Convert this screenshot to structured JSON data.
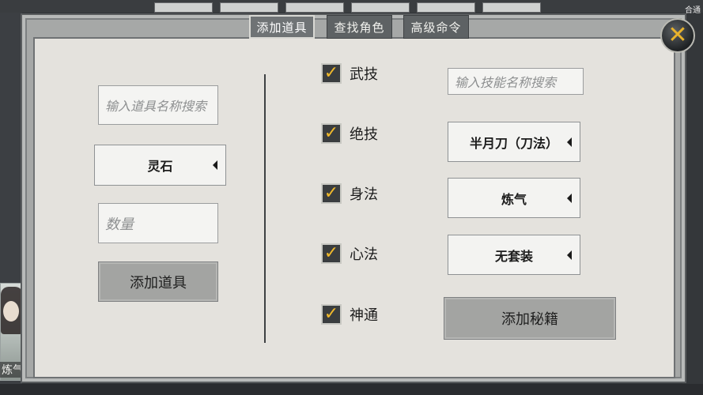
{
  "tabs": [
    {
      "label": "添加道具",
      "active": true
    },
    {
      "label": "查找角色",
      "active": false
    },
    {
      "label": "高级命令",
      "active": false
    }
  ],
  "close_icon": "close-x-icon",
  "left": {
    "item_search_placeholder": "输入道具名称搜索",
    "item_select_value": "灵石",
    "quantity_placeholder": "数量",
    "add_item_button": "添加道具"
  },
  "middle": {
    "checkboxes": [
      {
        "label": "武技",
        "checked": true
      },
      {
        "label": "绝技",
        "checked": true
      },
      {
        "label": "身法",
        "checked": true
      },
      {
        "label": "心法",
        "checked": true
      },
      {
        "label": "神通",
        "checked": true
      }
    ]
  },
  "right": {
    "skill_search_placeholder": "输入技能名称搜索",
    "skill_select_value": "半月刀（刀法）",
    "realm_select_value": "炼气",
    "set_select_value": "无套装",
    "add_book_button": "添加秘籍"
  },
  "background": {
    "portrait_label": "炼气",
    "corner_text": "合通"
  },
  "colors": {
    "check_mark": "#f0b92c",
    "panel_bg": "#e4e2dd",
    "tab_bg": "#5e6264"
  }
}
